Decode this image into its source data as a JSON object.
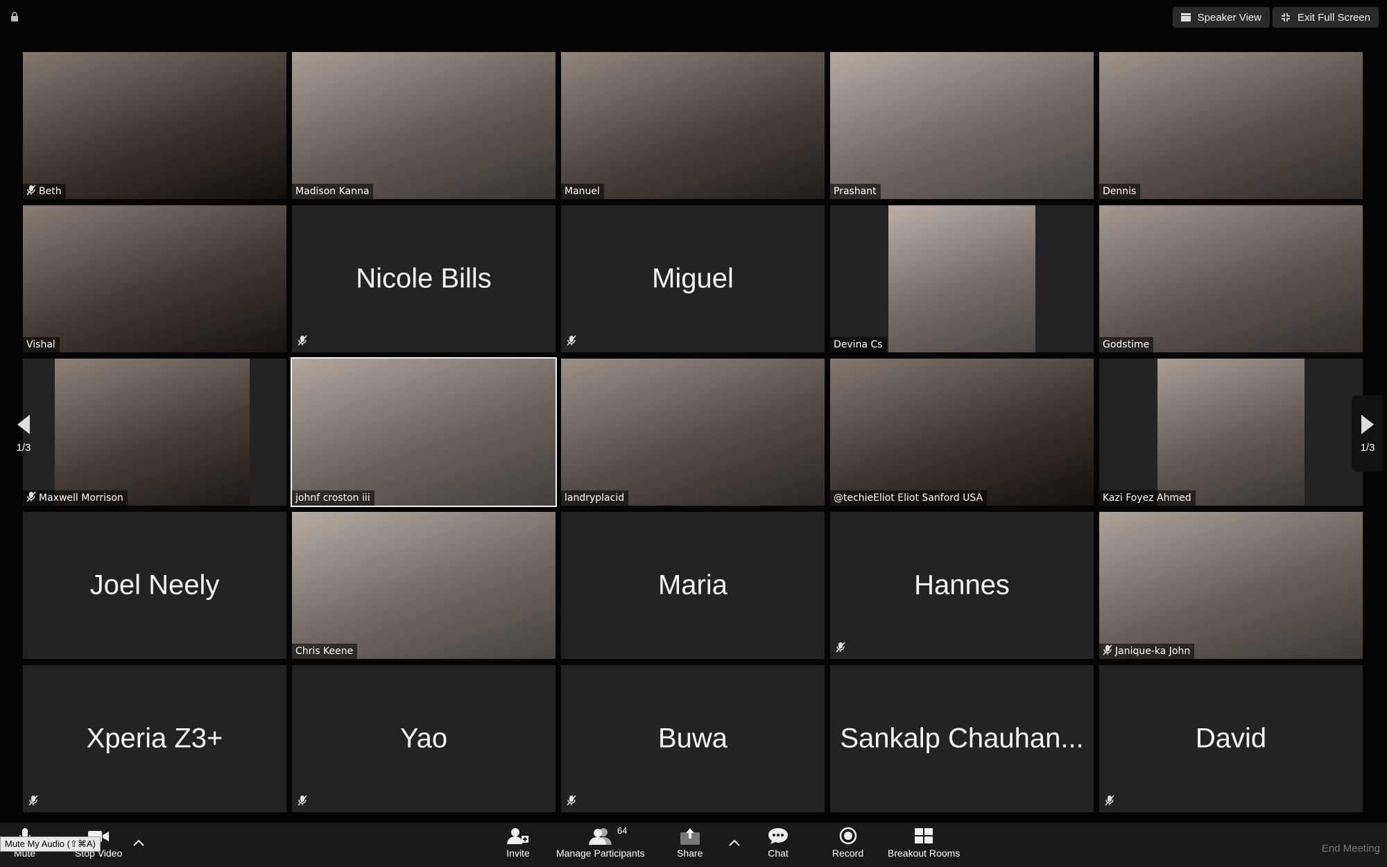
{
  "top_bar": {
    "speaker_view_label": "Speaker View",
    "exit_full_screen_label": "Exit Full Screen"
  },
  "pagination": {
    "left": "1/3",
    "right": "1/3"
  },
  "participants": [
    {
      "name": "Beth",
      "video": true,
      "muted": true
    },
    {
      "name": "Madison Kanna",
      "video": true,
      "muted": false
    },
    {
      "name": "Manuel",
      "video": true,
      "muted": false
    },
    {
      "name": "Prashant",
      "video": true,
      "muted": false
    },
    {
      "name": "Dennis",
      "video": true,
      "muted": false
    },
    {
      "name": "Vishal",
      "video": true,
      "muted": false
    },
    {
      "name": "Nicole Bills",
      "video": false,
      "muted": true
    },
    {
      "name": "Miguel",
      "video": false,
      "muted": true
    },
    {
      "name": "Devina Cs",
      "video": true,
      "muted": false
    },
    {
      "name": "Godstime",
      "video": true,
      "muted": false
    },
    {
      "name": "Maxwell Morrison",
      "video": true,
      "muted": true
    },
    {
      "name": "johnf croston iii",
      "video": true,
      "muted": false,
      "active_speaker": true
    },
    {
      "name": "landryplacid",
      "video": true,
      "muted": false
    },
    {
      "name": "@techieEliot Eliot Sanford USA",
      "video": true,
      "muted": false
    },
    {
      "name": "Kazi Foyez Ahmed",
      "video": true,
      "muted": false
    },
    {
      "name": "Joel Neely",
      "video": false,
      "muted": false
    },
    {
      "name": "Chris Keene",
      "video": true,
      "muted": false
    },
    {
      "name": "Maria",
      "video": false,
      "muted": false
    },
    {
      "name": "Hannes",
      "video": false,
      "muted": true
    },
    {
      "name": "Janique-ka John",
      "video": true,
      "muted": true
    },
    {
      "name": "Xperia Z3+",
      "video": false,
      "muted": true
    },
    {
      "name": "Yao",
      "video": false,
      "muted": true
    },
    {
      "name": "Buwa",
      "video": false,
      "muted": true
    },
    {
      "name": "Sankalp Chauhan...",
      "video": false,
      "muted": false
    },
    {
      "name": "David",
      "video": false,
      "muted": true
    }
  ],
  "toolbar": {
    "mute_label": "Mute",
    "stop_video_label": "Stop Video",
    "invite_label": "Invite",
    "manage_participants_label": "Manage Participants",
    "participant_count": "64",
    "share_label": "Share",
    "chat_label": "Chat",
    "record_label": "Record",
    "breakout_rooms_label": "Breakout Rooms",
    "end_meeting_label": "End Meeting",
    "tooltip": "Mute My Audio (⇧⌘A)"
  },
  "colors": {
    "background": "#050505",
    "tile": "#232323",
    "toolbar": "#1a1a1a"
  }
}
